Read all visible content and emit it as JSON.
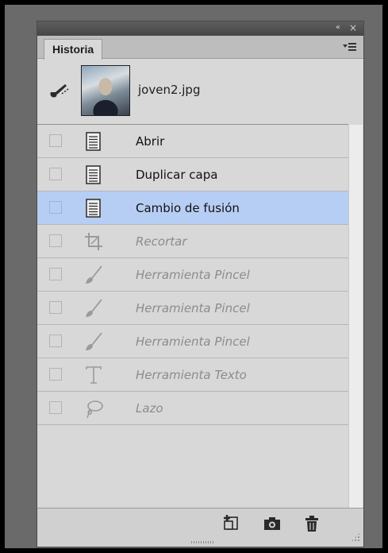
{
  "panel": {
    "tab_label": "Historia",
    "collapse_glyph": "«",
    "close_glyph": "×"
  },
  "snapshot": {
    "label": "joven2.jpg",
    "icon": "history-brush-source-icon"
  },
  "history": [
    {
      "label": "Abrir",
      "icon": "document-icon",
      "state": "active"
    },
    {
      "label": "Duplicar capa",
      "icon": "document-icon",
      "state": "active"
    },
    {
      "label": "Cambio de fusión",
      "icon": "document-icon",
      "state": "selected"
    },
    {
      "label": "Recortar",
      "icon": "crop-icon",
      "state": "inactive"
    },
    {
      "label": "Herramienta Pincel",
      "icon": "brush-icon",
      "state": "inactive"
    },
    {
      "label": "Herramienta Pincel",
      "icon": "brush-icon",
      "state": "inactive"
    },
    {
      "label": "Herramienta Pincel",
      "icon": "brush-icon",
      "state": "inactive"
    },
    {
      "label": "Herramienta Texto",
      "icon": "text-tool-icon",
      "state": "inactive"
    },
    {
      "label": "Lazo",
      "icon": "lasso-icon",
      "state": "inactive"
    }
  ],
  "colors": {
    "selected_row": "#b7cef4",
    "panel_bg": "#d8d8d8",
    "inactive_text": "#8c8c8c"
  }
}
